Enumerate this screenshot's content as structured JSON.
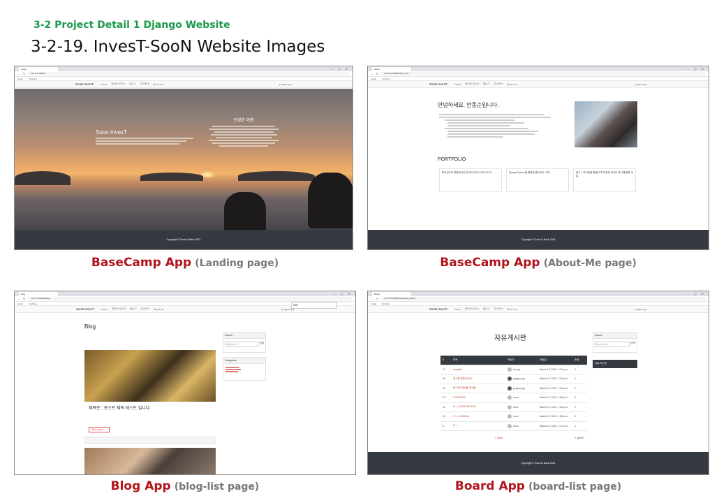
{
  "section_label": "3-2 Project Detail 1 Django Website",
  "slide_title": "3-2-19. InvesT-SooN Website Images",
  "screens": {
    "landing": {
      "caption_app": "BaseCamp App",
      "caption_page": "(Landing page)",
      "tab_title": "Home",
      "url": "127.0.0.1:8000",
      "brand": "SooN InvesT",
      "nav": [
        "Home",
        "웨이브 분석 ▾",
        "블로그",
        "게시판 ▾",
        "About me"
      ],
      "user": "jongsoo.g ▾",
      "hero_heading": "Soon InvesT",
      "side_heading": "진정한 여행",
      "footer": "Copyright © Soon-ki Back 2021"
    },
    "about": {
      "caption_app": "BaseCamp App",
      "caption_page": "(About-Me page)",
      "tab_title": "About",
      "url": "127.0.0.1:8000/about_me/",
      "brand": "SooN InvesT",
      "title": "안녕하세요. 안종순입니다.",
      "portfolio_heading": "PORTFOLIO",
      "cards": [
        "파이썬으로 환경데이터 분석하기 [PYCON 2017]",
        "Django/Python을 활용한 웹사이트 구축",
        "업그 + 파이썬을 활용한 투자/환경 데이터 분석 플랫폼 개발"
      ],
      "footer": "Copyright © Soon-ki Back 2021"
    },
    "blog": {
      "caption_app": "Blog App",
      "caption_page": "(blog-list page)",
      "tab_title": "Blog",
      "url": "127.0.0.1:8000/blog/",
      "brand": "SooN InvesT",
      "heading": "Blog",
      "post_title": "제목은 : 포스트 제목 테스트 입니다.",
      "read_more": "Read More →",
      "search_label": "Search",
      "search_placeholder": "Search for...",
      "search_button": "검색",
      "categories_label": "Categories",
      "zoom": "90%"
    },
    "board": {
      "caption_app": "Board App",
      "caption_page": "(board-list page)",
      "tab_title": "Board",
      "url": "127.0.0.1:8000/board/free_board/",
      "brand": "SooN InvesT",
      "title": "자유게시판",
      "columns": [
        "#",
        "제목",
        "작성자",
        "작성일",
        "조회"
      ],
      "rows": [
        {
          "no": "17",
          "title": "dsadsfsf",
          "author": "seung",
          "date": "March 13, 2021, 4:31 p.m.",
          "views": "1"
        },
        {
          "no": "16",
          "title": "게시판 제목 입니다.",
          "author": "jongsoo.gu",
          "date": "March 12, 2021, 7:33 p.m.",
          "views": "1"
        },
        {
          "no": "15",
          "title": "테스트(기능)을 게시물",
          "author": "jongsoo.gu",
          "date": "March 12, 2021, 7:30 p.m.",
          "views": "1"
        },
        {
          "no": "13",
          "title": "213212313",
          "author": "soon",
          "date": "March 12, 2021, 7:38 p.m.",
          "views": "0"
        },
        {
          "no": "11",
          "title": "ㅁㄴㅇ121212121212",
          "author": "soon",
          "date": "March 12, 2021, 7:38 p.m.",
          "views": "1"
        },
        {
          "no": "10",
          "title": "ㅁㄴㅇ2134124",
          "author": "soon",
          "date": "March 12, 2021, 7:38 p.m.",
          "views": "0"
        },
        {
          "no": "9",
          "title": "ㅁㄴ",
          "author": "soon",
          "date": "March 12, 2021, 7:37 p.m.",
          "views": "1"
        }
      ],
      "search_label": "Search",
      "search_placeholder": "Search for...",
      "search_button": "검색",
      "menu_item": "자유 게시판",
      "pager_prev": "« Older",
      "write_button": "✎ 글쓰기",
      "footer": "Copyright © Soon-ki Back 2021"
    }
  }
}
